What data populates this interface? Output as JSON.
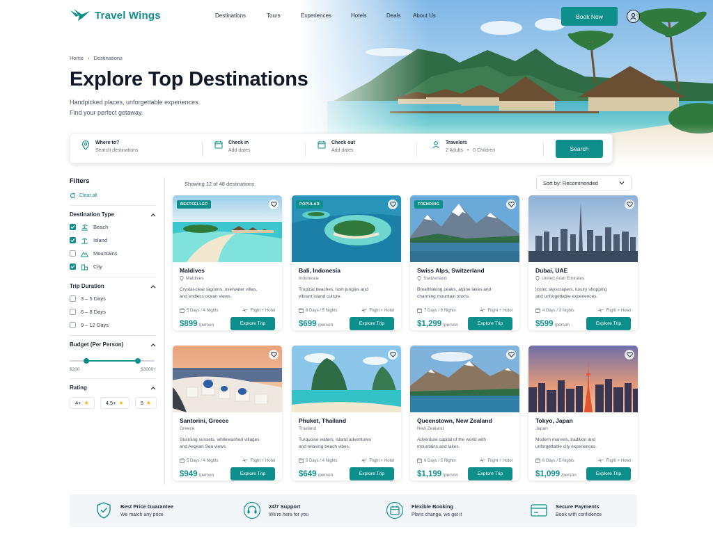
{
  "brand": {
    "name": "Travel Wings",
    "accent": "#0f8f8c"
  },
  "nav": {
    "links": [
      "Destinations",
      "Tours",
      "Experiences",
      "Hotels",
      "Deals",
      "About Us"
    ],
    "book_label": "Book Now",
    "user_icon": "user-icon"
  },
  "breadcrumb": {
    "home": "Home",
    "separator": "›",
    "current": "Destinations"
  },
  "hero": {
    "title": "Explore Top Destinations",
    "subtitle_line1": "Handpicked places, unforgettable experiences.",
    "subtitle_line2": "Find your perfect getaway."
  },
  "search": {
    "where_label": "Where to?",
    "where_placeholder": "Search destinations",
    "checkin_label": "Check in",
    "checkin_placeholder": "Add dates",
    "checkout_label": "Check out",
    "checkout_placeholder": "Add dates",
    "travelers_label": "Travelers",
    "travelers_adults": "2 Adults",
    "travelers_dot": "•",
    "travelers_children": "0 Children",
    "button": "Search"
  },
  "filters": {
    "title": "Filters",
    "clear": "Clear all",
    "type_title": "Destination Type",
    "types": [
      {
        "label": "Beach",
        "checked": true,
        "icon": "beach-icon"
      },
      {
        "label": "Island",
        "checked": true,
        "icon": "island-icon"
      },
      {
        "label": "Mountains",
        "checked": false,
        "icon": "mountain-icon"
      },
      {
        "label": "City",
        "checked": true,
        "icon": "city-icon"
      }
    ],
    "duration_title": "Trip Duration",
    "durations": [
      {
        "label": "3 – 5 Days",
        "checked": false
      },
      {
        "label": "6 – 8 Days",
        "checked": false
      },
      {
        "label": "9 – 12 Days",
        "checked": false
      }
    ],
    "budget_title": "Budget (Per Person)",
    "budget_min": "$200",
    "budget_max": "$3000+",
    "budget_low_fraction": 0.2,
    "budget_high_fraction": 0.8,
    "rating_title": "Rating",
    "ratings": [
      "4+",
      "4.5+",
      "5"
    ]
  },
  "results": {
    "showing": "Showing 12 of 48 destinations",
    "sort": "Sort by: Recommended"
  },
  "cards": [
    {
      "badge": "BESTSELLER",
      "name": "Maldives",
      "location": "Maldives",
      "desc1": "Crystal-clear lagoons, overwater villas,",
      "desc2": "and endless ocean views.",
      "duration": "5 Days / 4 Nights",
      "includes": "Flight + Hotel",
      "price": "$899",
      "per": "/person",
      "cta": "Explore Trip"
    },
    {
      "badge": "POPULAR",
      "name": "Bali, Indonesia",
      "location": "Indonesia",
      "desc1": "Tropical beaches, lush jungles and",
      "desc2": "vibrant island culture.",
      "duration": "6 Days / 5 Nights",
      "includes": "Flight + Hotel",
      "price": "$699",
      "per": "/person",
      "cta": "Explore Trip"
    },
    {
      "badge": "TRENDING",
      "name": "Swiss Alps, Switzerland",
      "location": "Switzerland",
      "desc1": "Breathtaking peaks, alpine lakes and",
      "desc2": "charming mountain towns.",
      "duration": "7 Days / 6 Nights",
      "includes": "Flight + Hotel",
      "price": "$1,299",
      "per": "/person",
      "cta": "Explore Trip"
    },
    {
      "badge": "",
      "name": "Dubai, UAE",
      "location": "United Arab Emirates",
      "desc1": "Iconic skyscrapers, luxury shopping",
      "desc2": "and unforgettable experiences.",
      "duration": "4 Days / 3 Nights",
      "includes": "Flight + Hotel",
      "price": "$599",
      "per": "/person",
      "cta": "Explore Trip"
    },
    {
      "badge": "",
      "name": "Santorini, Greece",
      "location": "Greece",
      "desc1": "Stunning sunsets, whitewashed villages",
      "desc2": "and Aegean Sea views.",
      "duration": "5 Days / 4 Nights",
      "includes": "Flight + Hotel",
      "price": "$949",
      "per": "/person",
      "cta": "Explore Trip"
    },
    {
      "badge": "",
      "name": "Phuket, Thailand",
      "location": "Thailand",
      "desc1": "Turquoise waters, island adventures",
      "desc2": "and relaxing beach vibes.",
      "duration": "5 Days / 4 Nights",
      "includes": "Flight + Hotel",
      "price": "$649",
      "per": "/person",
      "cta": "Explore Trip"
    },
    {
      "badge": "",
      "name": "Queenstown, New Zealand",
      "location": "New Zealand",
      "desc1": "Adventure capital of the world with",
      "desc2": "mountains and lakes.",
      "duration": "6 Days / 5 Nights",
      "includes": "Flight + Hotel",
      "price": "$1,199",
      "per": "/person",
      "cta": "Explore Trip"
    },
    {
      "badge": "",
      "name": "Tokyo, Japan",
      "location": "Japan",
      "desc1": "Modern marvels, tradition and",
      "desc2": "unforgettable city experiences.",
      "duration": "6 Days / 5 Nights",
      "includes": "Flight + Hotel",
      "price": "$1,099",
      "per": "/person",
      "cta": "Explore Trip"
    }
  ],
  "features": [
    {
      "title": "Best Price Guarantee",
      "sub": "We match any price",
      "icon": "shield-check-icon"
    },
    {
      "title": "24/7 Support",
      "sub": "We're here for you",
      "icon": "headset-icon"
    },
    {
      "title": "Flexible Booking",
      "sub": "Plans change, we get it",
      "icon": "calendar-icon"
    },
    {
      "title": "Secure Payments",
      "sub": "Book with confidence",
      "icon": "credit-card-icon"
    }
  ]
}
